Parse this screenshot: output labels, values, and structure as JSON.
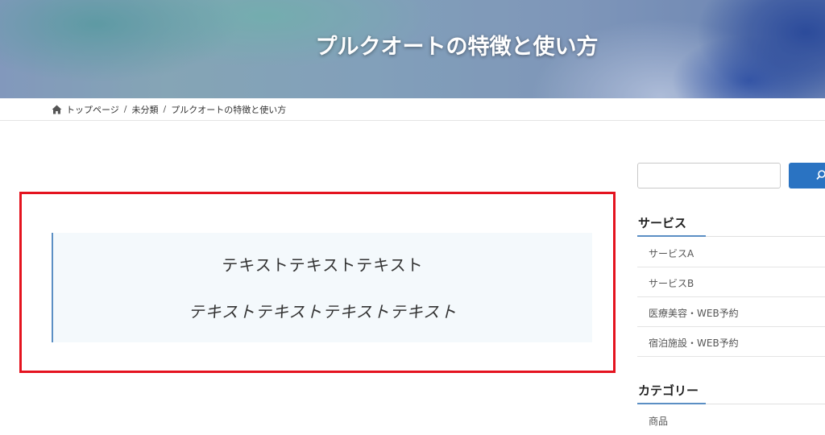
{
  "hero": {
    "title": "プルクオートの特徴と使い方"
  },
  "breadcrumb": {
    "home_icon": "home-icon",
    "items": [
      "トップページ",
      "未分類",
      "プルクオートの特徴と使い方"
    ],
    "separator": "/"
  },
  "quote": {
    "line1": "テキストテキストテキスト",
    "line2": "テキストテキストテキストテキスト"
  },
  "search": {
    "placeholder": "",
    "button_icon": "search-icon"
  },
  "sidebar": {
    "service_title": "サービス",
    "service_items": [
      {
        "label": "サービスA"
      },
      {
        "label": "サービスB"
      },
      {
        "label": "医療美容・WEB予約"
      },
      {
        "label": "宿泊施設・WEB予約"
      }
    ],
    "category_title": "カテゴリー",
    "category_items": [
      {
        "label": "商品"
      }
    ]
  },
  "colors": {
    "accent": "#5b8fc4",
    "search_button": "#2a73c2",
    "highlight_frame": "#e4131f",
    "quote_background": "#f4f9fc"
  }
}
